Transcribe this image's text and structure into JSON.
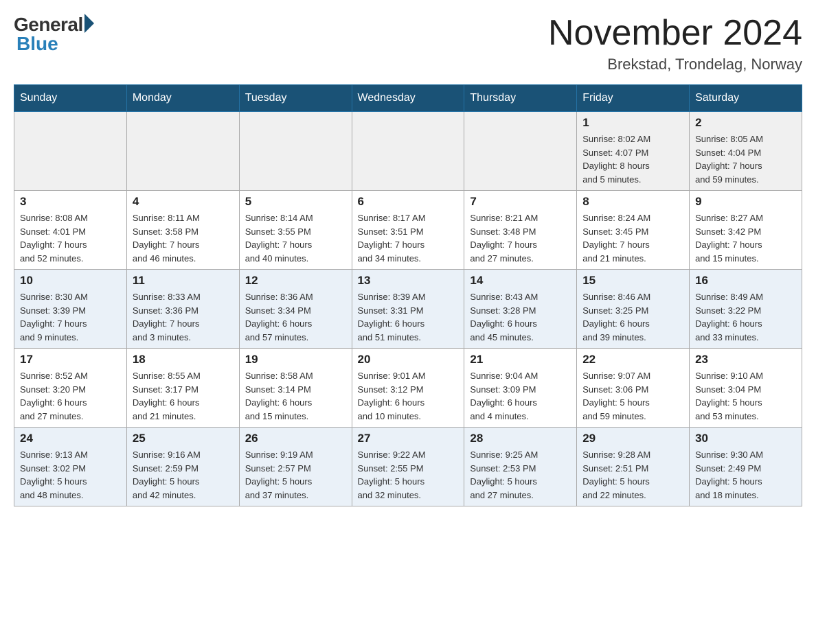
{
  "header": {
    "logo_general": "General",
    "logo_blue": "Blue",
    "month_title": "November 2024",
    "location": "Brekstad, Trondelag, Norway"
  },
  "days_of_week": [
    "Sunday",
    "Monday",
    "Tuesday",
    "Wednesday",
    "Thursday",
    "Friday",
    "Saturday"
  ],
  "weeks": [
    [
      {
        "day": "",
        "info": ""
      },
      {
        "day": "",
        "info": ""
      },
      {
        "day": "",
        "info": ""
      },
      {
        "day": "",
        "info": ""
      },
      {
        "day": "",
        "info": ""
      },
      {
        "day": "1",
        "info": "Sunrise: 8:02 AM\nSunset: 4:07 PM\nDaylight: 8 hours\nand 5 minutes."
      },
      {
        "day": "2",
        "info": "Sunrise: 8:05 AM\nSunset: 4:04 PM\nDaylight: 7 hours\nand 59 minutes."
      }
    ],
    [
      {
        "day": "3",
        "info": "Sunrise: 8:08 AM\nSunset: 4:01 PM\nDaylight: 7 hours\nand 52 minutes."
      },
      {
        "day": "4",
        "info": "Sunrise: 8:11 AM\nSunset: 3:58 PM\nDaylight: 7 hours\nand 46 minutes."
      },
      {
        "day": "5",
        "info": "Sunrise: 8:14 AM\nSunset: 3:55 PM\nDaylight: 7 hours\nand 40 minutes."
      },
      {
        "day": "6",
        "info": "Sunrise: 8:17 AM\nSunset: 3:51 PM\nDaylight: 7 hours\nand 34 minutes."
      },
      {
        "day": "7",
        "info": "Sunrise: 8:21 AM\nSunset: 3:48 PM\nDaylight: 7 hours\nand 27 minutes."
      },
      {
        "day": "8",
        "info": "Sunrise: 8:24 AM\nSunset: 3:45 PM\nDaylight: 7 hours\nand 21 minutes."
      },
      {
        "day": "9",
        "info": "Sunrise: 8:27 AM\nSunset: 3:42 PM\nDaylight: 7 hours\nand 15 minutes."
      }
    ],
    [
      {
        "day": "10",
        "info": "Sunrise: 8:30 AM\nSunset: 3:39 PM\nDaylight: 7 hours\nand 9 minutes."
      },
      {
        "day": "11",
        "info": "Sunrise: 8:33 AM\nSunset: 3:36 PM\nDaylight: 7 hours\nand 3 minutes."
      },
      {
        "day": "12",
        "info": "Sunrise: 8:36 AM\nSunset: 3:34 PM\nDaylight: 6 hours\nand 57 minutes."
      },
      {
        "day": "13",
        "info": "Sunrise: 8:39 AM\nSunset: 3:31 PM\nDaylight: 6 hours\nand 51 minutes."
      },
      {
        "day": "14",
        "info": "Sunrise: 8:43 AM\nSunset: 3:28 PM\nDaylight: 6 hours\nand 45 minutes."
      },
      {
        "day": "15",
        "info": "Sunrise: 8:46 AM\nSunset: 3:25 PM\nDaylight: 6 hours\nand 39 minutes."
      },
      {
        "day": "16",
        "info": "Sunrise: 8:49 AM\nSunset: 3:22 PM\nDaylight: 6 hours\nand 33 minutes."
      }
    ],
    [
      {
        "day": "17",
        "info": "Sunrise: 8:52 AM\nSunset: 3:20 PM\nDaylight: 6 hours\nand 27 minutes."
      },
      {
        "day": "18",
        "info": "Sunrise: 8:55 AM\nSunset: 3:17 PM\nDaylight: 6 hours\nand 21 minutes."
      },
      {
        "day": "19",
        "info": "Sunrise: 8:58 AM\nSunset: 3:14 PM\nDaylight: 6 hours\nand 15 minutes."
      },
      {
        "day": "20",
        "info": "Sunrise: 9:01 AM\nSunset: 3:12 PM\nDaylight: 6 hours\nand 10 minutes."
      },
      {
        "day": "21",
        "info": "Sunrise: 9:04 AM\nSunset: 3:09 PM\nDaylight: 6 hours\nand 4 minutes."
      },
      {
        "day": "22",
        "info": "Sunrise: 9:07 AM\nSunset: 3:06 PM\nDaylight: 5 hours\nand 59 minutes."
      },
      {
        "day": "23",
        "info": "Sunrise: 9:10 AM\nSunset: 3:04 PM\nDaylight: 5 hours\nand 53 minutes."
      }
    ],
    [
      {
        "day": "24",
        "info": "Sunrise: 9:13 AM\nSunset: 3:02 PM\nDaylight: 5 hours\nand 48 minutes."
      },
      {
        "day": "25",
        "info": "Sunrise: 9:16 AM\nSunset: 2:59 PM\nDaylight: 5 hours\nand 42 minutes."
      },
      {
        "day": "26",
        "info": "Sunrise: 9:19 AM\nSunset: 2:57 PM\nDaylight: 5 hours\nand 37 minutes."
      },
      {
        "day": "27",
        "info": "Sunrise: 9:22 AM\nSunset: 2:55 PM\nDaylight: 5 hours\nand 32 minutes."
      },
      {
        "day": "28",
        "info": "Sunrise: 9:25 AM\nSunset: 2:53 PM\nDaylight: 5 hours\nand 27 minutes."
      },
      {
        "day": "29",
        "info": "Sunrise: 9:28 AM\nSunset: 2:51 PM\nDaylight: 5 hours\nand 22 minutes."
      },
      {
        "day": "30",
        "info": "Sunrise: 9:30 AM\nSunset: 2:49 PM\nDaylight: 5 hours\nand 18 minutes."
      }
    ]
  ]
}
